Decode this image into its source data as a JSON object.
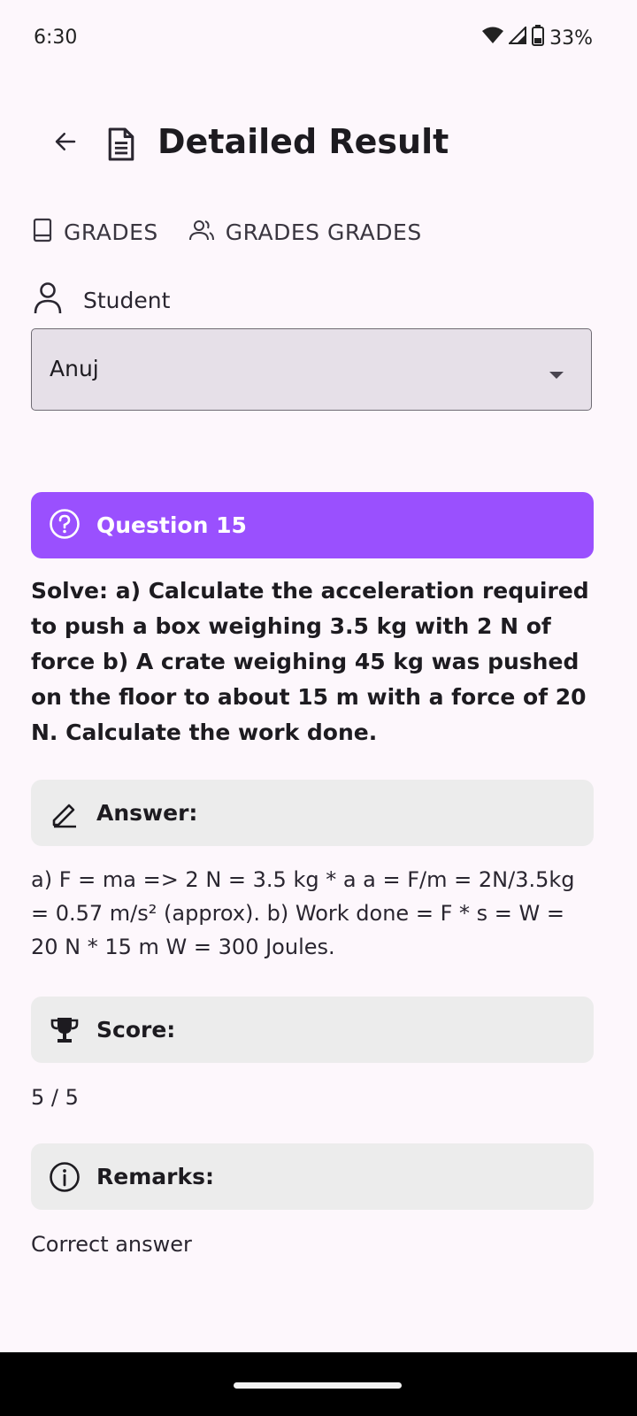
{
  "status": {
    "time": "6:30",
    "battery": "33%"
  },
  "header": {
    "title": "Detailed Result"
  },
  "tabs": [
    {
      "label": "GRADES",
      "icon": "book-icon"
    },
    {
      "label": "GRADES GRADES",
      "icon": "group-icon"
    }
  ],
  "student": {
    "label": "Student",
    "selected": "Anuj"
  },
  "question": {
    "title": "Question 15",
    "text": "Solve: a) Calculate the acceleration required to push a box weighing 3.5 kg with 2 N of force b) A crate weighing 45 kg was pushed on the floor to about 15 m with a force of 20 N. Calculate the work done."
  },
  "answer": {
    "title": "Answer:",
    "text": "a) F = ma => 2 N = 3.5 kg * a a = F/m = 2N/3.5kg = 0.57 m/s² (approx). b) Work done = F * s = W = 20 N * 15 m W = 300 Joules."
  },
  "score": {
    "title": "Score:",
    "value": "5 / 5"
  },
  "remarks": {
    "title": "Remarks:",
    "text": "Correct answer"
  },
  "colors": {
    "accent": "#9a50fe",
    "card": "#ececec",
    "background": "#fdf7fc"
  }
}
